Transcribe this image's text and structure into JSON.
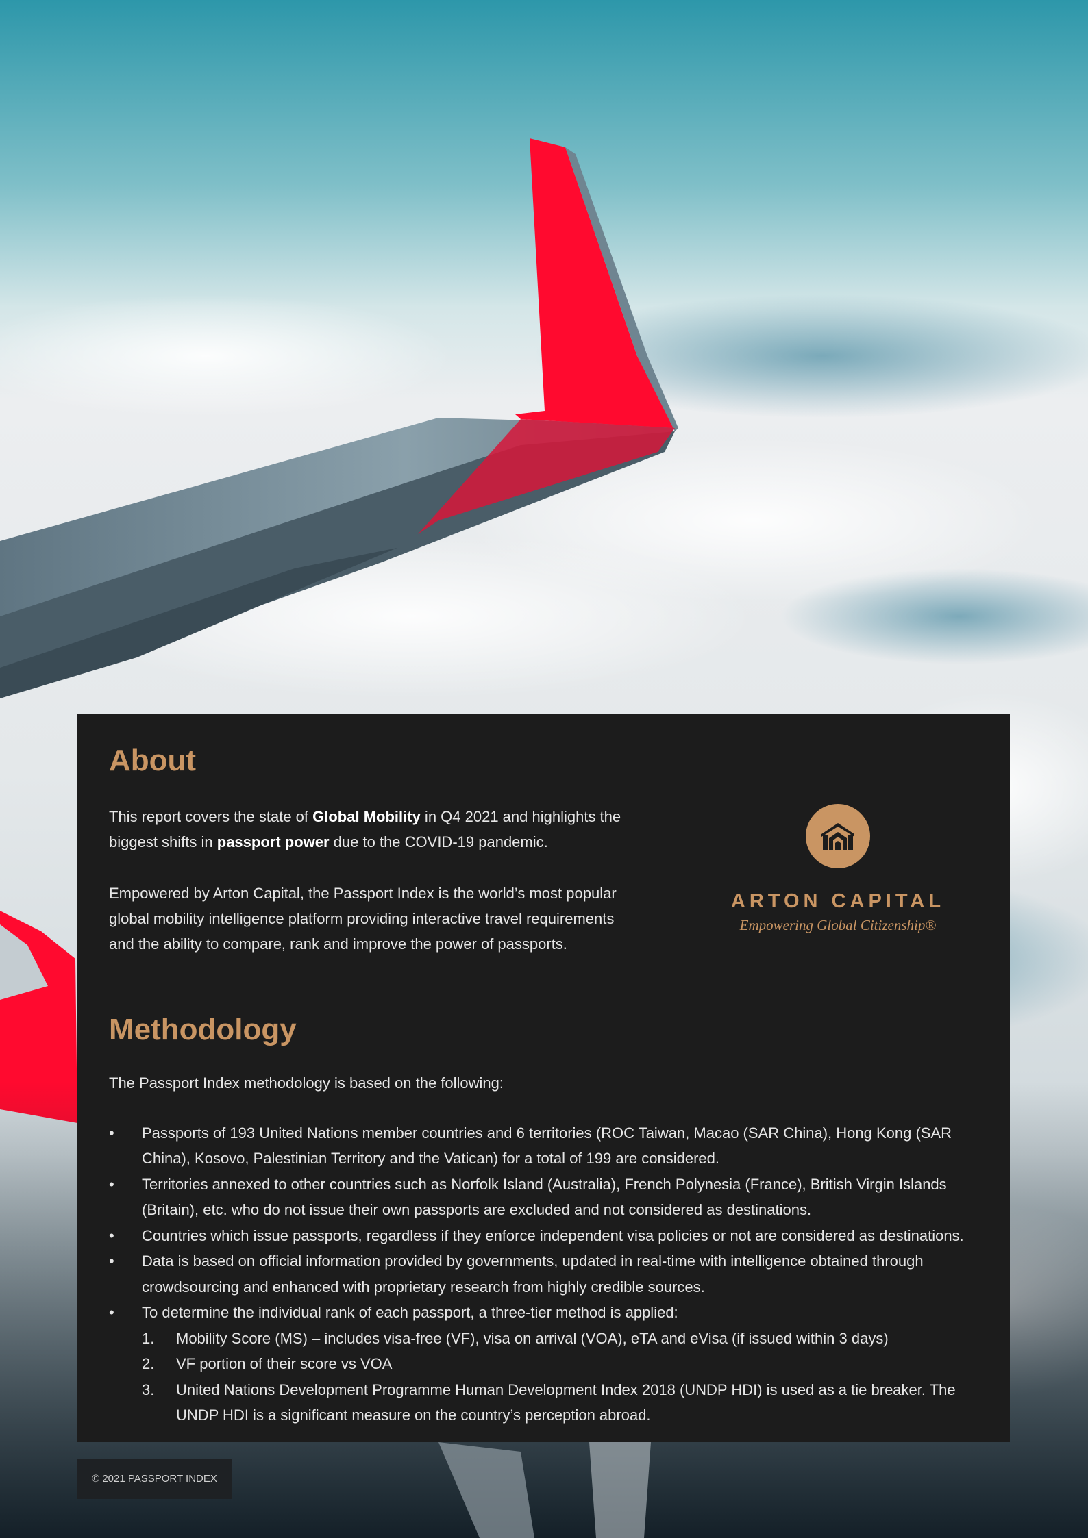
{
  "colors": {
    "accent": "#c99563",
    "panel": "#1c1c1c",
    "wing_red": "#ff0a2f"
  },
  "about": {
    "title": "About",
    "p1_pre": "This report covers the state of ",
    "p1_bold1": "Global Mobility",
    "p1_mid": " in Q4 2021 and highlights the biggest shifts in ",
    "p1_bold2": "passport power",
    "p1_post": " due to the COVID-19 pandemic.",
    "p2": "Empowered by Arton Capital, the Passport Index is the world’s most popular global mobility intelligence platform providing interactive travel requirements and the ability to compare, rank and improve the power of passports."
  },
  "logo": {
    "icon": "arton-house-icon",
    "name": "ARTON CAPITAL",
    "tagline": "Empowering Global Citizenship®"
  },
  "methodology": {
    "title": "Methodology",
    "intro": "The Passport Index methodology is based on the following:",
    "bullet": "•",
    "items": [
      "Passports of 193 United Nations member countries and 6 territories (ROC Taiwan, Macao (SAR China), Hong Kong (SAR China), Kosovo, Palestinian Territory and the Vatican) for a total of 199 are considered.",
      "Territories annexed to other countries such as Norfolk Island (Australia), French Polynesia (France), British Virgin Islands (Britain), etc. who do not issue their own passports are excluded and not considered as destinations.",
      "Countries which issue passports, regardless if they enforce independent visa policies or not are considered as destinations.",
      "Data is based on official information provided by governments, updated in real-time with intelligence obtained through crowdsourcing and enhanced with proprietary research from highly credible sources.",
      "To determine the individual rank of each passport, a three-tier method is applied:"
    ],
    "tiers": [
      {
        "num": "1.",
        "text": "Mobility Score (MS) – includes visa-free (VF), visa on arrival (VOA), eTA and eVisa (if issued within 3 days)"
      },
      {
        "num": "2.",
        "text": "VF portion of their score vs VOA"
      },
      {
        "num": "3.",
        "text": "United Nations Development Programme Human Development Index 2018 (UNDP HDI) is used as a tie breaker. The UNDP HDI is a significant measure on the country’s perception abroad."
      }
    ]
  },
  "footer": {
    "text": "© 2021 PASSPORT INDEX"
  }
}
